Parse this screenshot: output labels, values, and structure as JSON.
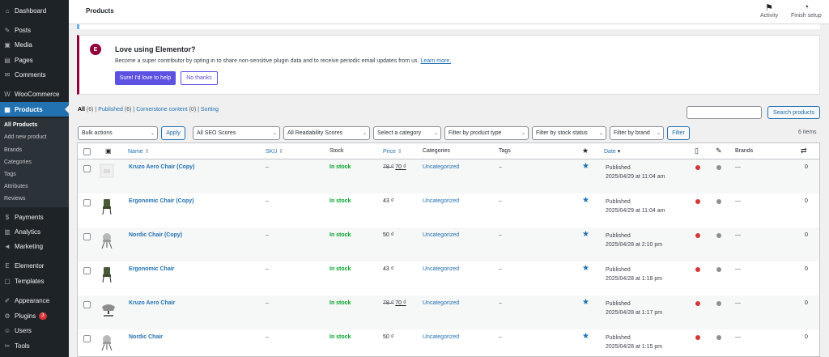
{
  "sidebar": {
    "items": [
      {
        "label": "Dashboard",
        "icon": "dashboard-icon",
        "glyph": "⌂"
      },
      {
        "label": "Posts",
        "icon": "pin-icon",
        "glyph": "✎"
      },
      {
        "label": "Media",
        "icon": "media-icon",
        "glyph": "▣"
      },
      {
        "label": "Pages",
        "icon": "pages-icon",
        "glyph": "▤"
      },
      {
        "label": "Comments",
        "icon": "comments-icon",
        "glyph": "✉"
      },
      {
        "label": "WooCommerce",
        "icon": "woocommerce-icon",
        "glyph": "W"
      },
      {
        "label": "Products",
        "icon": "products-icon",
        "glyph": "▦"
      },
      {
        "label": "Payments",
        "icon": "payments-icon",
        "glyph": "$"
      },
      {
        "label": "Analytics",
        "icon": "analytics-icon",
        "glyph": "▥"
      },
      {
        "label": "Marketing",
        "icon": "marketing-icon",
        "glyph": "◄"
      },
      {
        "label": "Elementor",
        "icon": "elementor-icon",
        "glyph": "E"
      },
      {
        "label": "Templates",
        "icon": "templates-icon",
        "glyph": "▢"
      },
      {
        "label": "Appearance",
        "icon": "appearance-icon",
        "glyph": "✐"
      },
      {
        "label": "Plugins",
        "icon": "plugins-icon",
        "glyph": "⚙",
        "badge": "3"
      },
      {
        "label": "Users",
        "icon": "users-icon",
        "glyph": "☺"
      },
      {
        "label": "Tools",
        "icon": "tools-icon",
        "glyph": "✂"
      }
    ],
    "submenu": [
      "All Products",
      "Add new product",
      "Brands",
      "Categories",
      "Tags",
      "Attributes",
      "Reviews"
    ]
  },
  "header": {
    "title": "Products",
    "activity_label": "Activity",
    "finish_setup_label": "Finish setup"
  },
  "notice": {
    "logo": "E",
    "title": "Love using Elementor?",
    "text": "Become a super contributor by opting in to share non-sensitive plugin data and to receive periodic email updates from us.",
    "learn_more": "Learn more.",
    "primary_button": "Sure! I'd love to help",
    "secondary_button": "No thanks"
  },
  "views": {
    "all": "All",
    "all_count": "(6)",
    "published": "Published",
    "published_count": "(6)",
    "cornerstone": "Cornerstone content",
    "cornerstone_count": "(0)",
    "sorting": "Sorting",
    "separator": "|"
  },
  "search": {
    "button": "Search products",
    "value": ""
  },
  "filters": {
    "bulk_actions": "Bulk actions",
    "apply": "Apply",
    "seo": "All SEO Scores",
    "readability": "All Readability Scores",
    "category": "Select a category",
    "product_type": "Filter by product type",
    "stock_status": "Filter by stock status",
    "brand": "Filter by brand",
    "filter_button": "Filter",
    "items_count": "6 items"
  },
  "table": {
    "headers": {
      "name": "Name",
      "sku": "SKU",
      "stock": "Stock",
      "price": "Price",
      "categories": "Categories",
      "tags": "Tags",
      "date": "Date",
      "brands": "Brands"
    },
    "rows": [
      {
        "name": "Kruzo Aero Chair (Copy)",
        "sku": "–",
        "stock": "In stock",
        "price_old": "78 ₫",
        "price": "70 ₫",
        "category": "Uncategorized",
        "tags": "–",
        "status": "Published",
        "date": "2025/04/29 at 11:04 am",
        "brands": "—",
        "count": "0",
        "thumb": "placeholder",
        "seo_color": "#d63638",
        "read_color": "#8c8f94"
      },
      {
        "name": "Ergonomic Chair (Copy)",
        "sku": "–",
        "stock": "In stock",
        "price_old": "",
        "price": "43 ₫",
        "category": "Uncategorized",
        "tags": "–",
        "status": "Published",
        "date": "2025/04/29 at 11:04 am",
        "brands": "—",
        "count": "0",
        "thumb": "chair-green",
        "seo_color": "#d63638",
        "read_color": "#8c8f94"
      },
      {
        "name": "Nordic Chair (Copy)",
        "sku": "–",
        "stock": "In stock",
        "price_old": "",
        "price": "50 ₫",
        "category": "Uncategorized",
        "tags": "–",
        "status": "Published",
        "date": "2025/04/28 at 2:10 pm",
        "brands": "—",
        "count": "0",
        "thumb": "chair-gray",
        "seo_color": "#d63638",
        "read_color": "#8c8f94"
      },
      {
        "name": "Ergonomic Chair",
        "sku": "–",
        "stock": "In stock",
        "price_old": "",
        "price": "43 ₫",
        "category": "Uncategorized",
        "tags": "–",
        "status": "Published",
        "date": "2025/04/28 at 1:18 pm",
        "brands": "—",
        "count": "0",
        "thumb": "chair-green",
        "seo_color": "#d63638",
        "read_color": "#8c8f94"
      },
      {
        "name": "Kruzo Aero Chair",
        "sku": "–",
        "stock": "In stock",
        "price_old": "78 ₫",
        "price": "70 ₫",
        "category": "Uncategorized",
        "tags": "–",
        "status": "Published",
        "date": "2025/04/28 at 1:17 pm",
        "brands": "—",
        "count": "0",
        "thumb": "chair-aero",
        "seo_color": "#d63638",
        "read_color": "#8c8f94"
      },
      {
        "name": "Nordic Chair",
        "sku": "–",
        "stock": "In stock",
        "price_old": "",
        "price": "50 ₫",
        "category": "Uncategorized",
        "tags": "–",
        "status": "Published",
        "date": "2025/04/28 at 1:15 pm",
        "brands": "—",
        "count": "0",
        "thumb": "chair-gray",
        "seo_color": "#d63638",
        "read_color": "#8c8f94"
      }
    ]
  }
}
